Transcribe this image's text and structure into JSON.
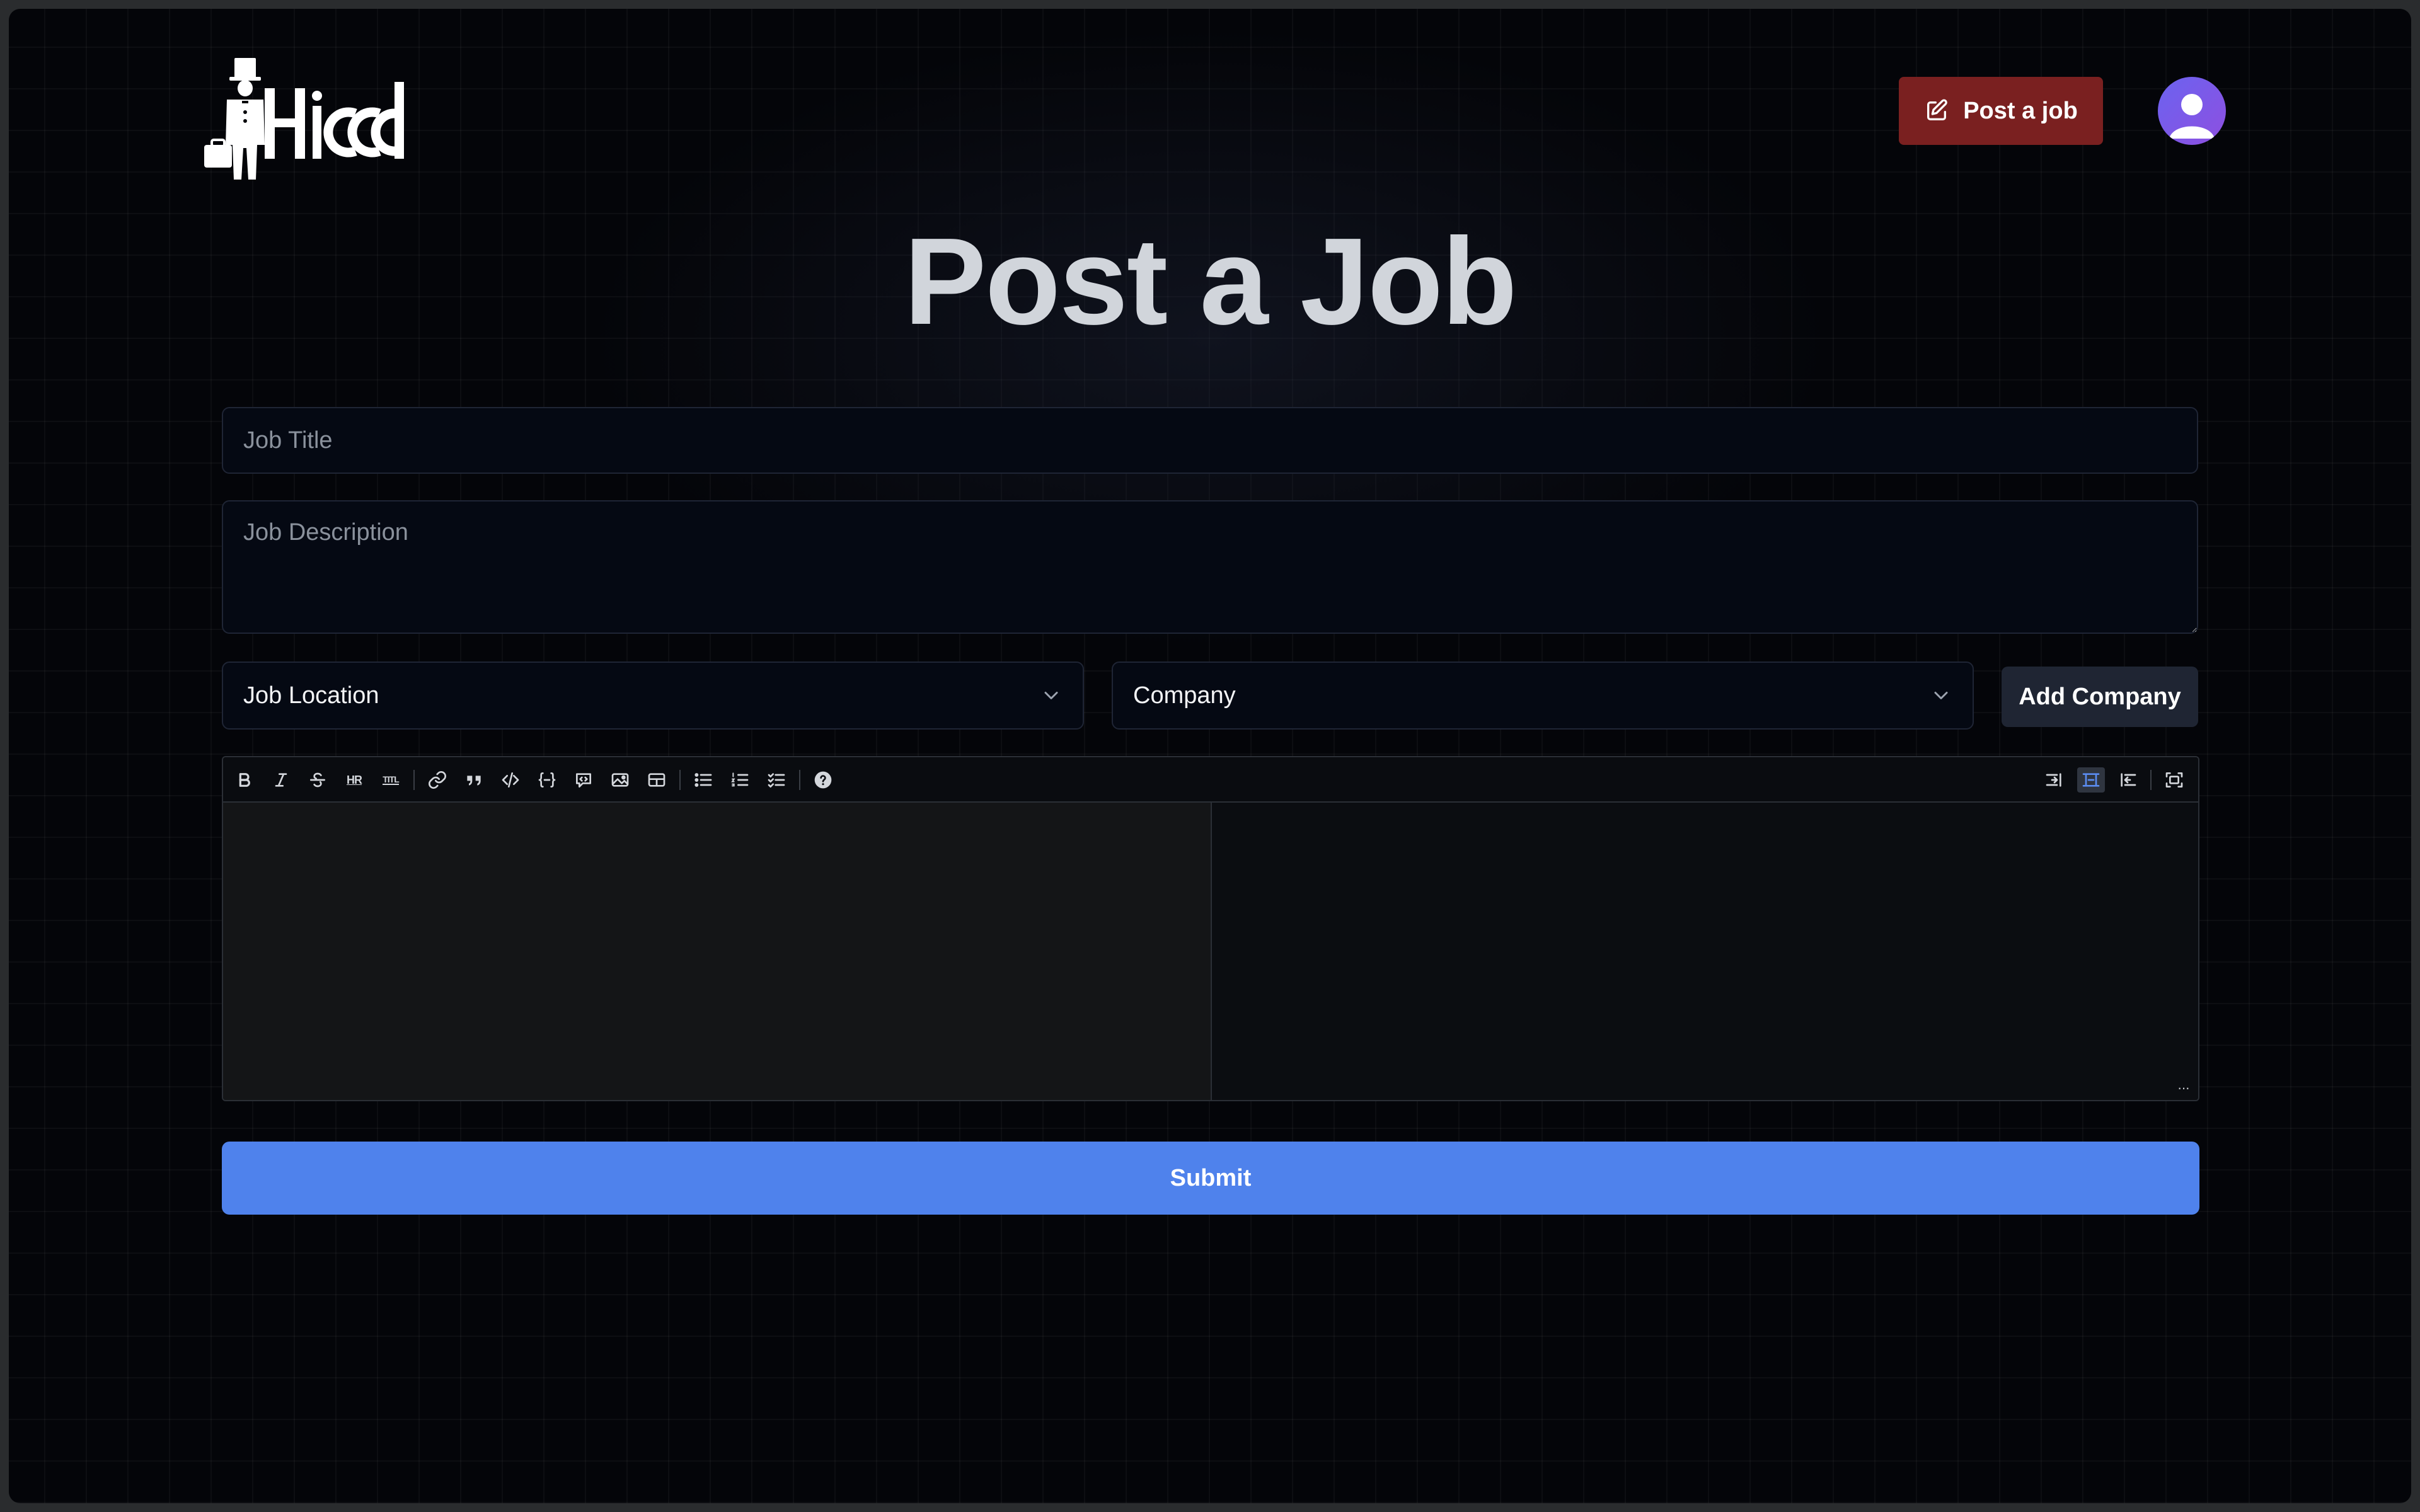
{
  "app": {
    "logo_text": "Hicrd"
  },
  "header": {
    "post_job_label": "Post a job"
  },
  "page": {
    "title": "Post a Job"
  },
  "form": {
    "job_title_placeholder": "Job Title",
    "job_description_placeholder": "Job Description",
    "location_label": "Job Location",
    "company_label": "Company",
    "add_company_label": "Add Company",
    "submit_label": "Submit"
  },
  "editor": {
    "toolbar_left": [
      "bold-icon",
      "italic-icon",
      "strikethrough-icon",
      "hr-icon",
      "title-icon",
      "link-icon",
      "quote-icon",
      "code-icon",
      "code-block-icon",
      "comment-icon",
      "image-icon",
      "table-icon",
      "unordered-list-icon",
      "ordered-list-icon",
      "checklist-icon",
      "help-icon"
    ],
    "toolbar_right": [
      "edit-mode-icon",
      "live-mode-icon",
      "preview-mode-icon",
      "fullscreen-icon"
    ],
    "toolbar_hr_text": "HR",
    "toolbar_title_text": "TITL",
    "active_mode": "live",
    "content": ""
  },
  "colors": {
    "background": "#040509",
    "post_job_button": "#7a2020",
    "submit_button": "#4f82ec",
    "avatar_gradient_start": "#6b63f0",
    "avatar_gradient_end": "#8e4fe0",
    "title_text": "#d1d5db"
  }
}
